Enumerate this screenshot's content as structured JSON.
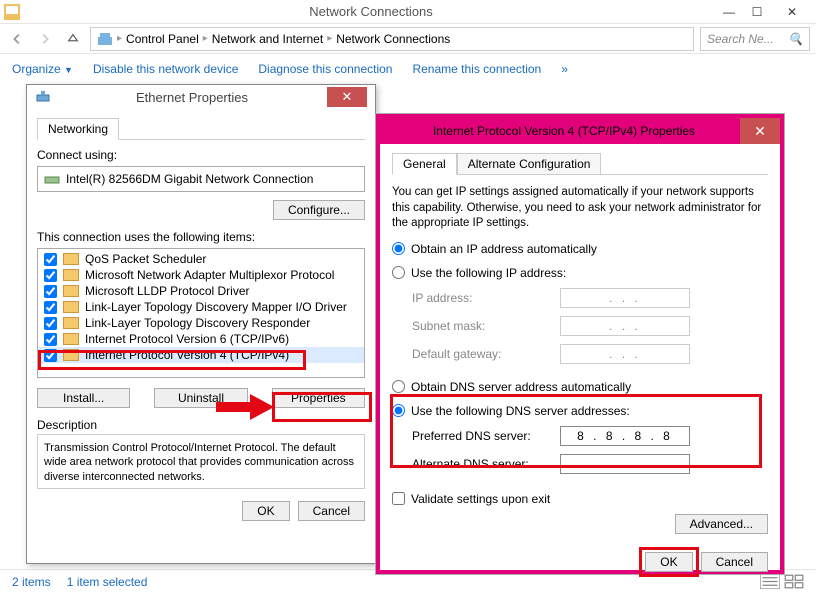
{
  "window": {
    "title": "Network Connections",
    "breadcrumb": [
      "Control Panel",
      "Network and Internet",
      "Network Connections"
    ],
    "search_placeholder": "Search Ne...",
    "toolbar": {
      "organize": "Organize",
      "disable": "Disable this network device",
      "diagnose": "Diagnose this connection",
      "rename": "Rename this connection",
      "overflow": "»"
    },
    "status": {
      "items": "2 items",
      "selected": "1 item selected"
    }
  },
  "ethernet_dialog": {
    "title": "Ethernet Properties",
    "tab": "Networking",
    "connect_using_label": "Connect using:",
    "adapter": "Intel(R) 82566DM Gigabit Network Connection",
    "configure_btn": "Configure...",
    "items_label": "This connection uses the following items:",
    "items": [
      {
        "label": "QoS Packet Scheduler",
        "checked": true
      },
      {
        "label": "Microsoft Network Adapter Multiplexor Protocol",
        "checked": true
      },
      {
        "label": "Microsoft LLDP Protocol Driver",
        "checked": true
      },
      {
        "label": "Link-Layer Topology Discovery Mapper I/O Driver",
        "checked": true
      },
      {
        "label": "Link-Layer Topology Discovery Responder",
        "checked": true
      },
      {
        "label": "Internet Protocol Version 6 (TCP/IPv6)",
        "checked": true
      },
      {
        "label": "Internet Protocol Version 4 (TCP/IPv4)",
        "checked": true
      }
    ],
    "install_btn": "Install...",
    "uninstall_btn": "Uninstall",
    "properties_btn": "Properties",
    "description_label": "Description",
    "description_text": "Transmission Control Protocol/Internet Protocol. The default wide area network protocol that provides communication across diverse interconnected networks.",
    "ok_btn": "OK",
    "cancel_btn": "Cancel"
  },
  "ipv4_dialog": {
    "title": "Internet Protocol Version 4 (TCP/IPv4) Properties",
    "tabs": {
      "general": "General",
      "alt": "Alternate Configuration"
    },
    "help": "You can get IP settings assigned automatically if your network supports this capability. Otherwise, you need to ask your network administrator for the appropriate IP settings.",
    "ip_auto": "Obtain an IP address automatically",
    "ip_manual": "Use the following IP address:",
    "ip_address_lbl": "IP address:",
    "subnet_lbl": "Subnet mask:",
    "gateway_lbl": "Default gateway:",
    "dns_auto": "Obtain DNS server address automatically",
    "dns_manual": "Use the following DNS server addresses:",
    "pref_dns_lbl": "Preferred DNS server:",
    "alt_dns_lbl": "Alternate DNS server:",
    "pref_dns_val": "8 . 8 . 8 . 8",
    "alt_dns_val": ".     .     .",
    "empty_ip": ".     .     .",
    "validate_lbl": "Validate settings upon exit",
    "advanced_btn": "Advanced...",
    "ok_btn": "OK",
    "cancel_btn": "Cancel"
  }
}
